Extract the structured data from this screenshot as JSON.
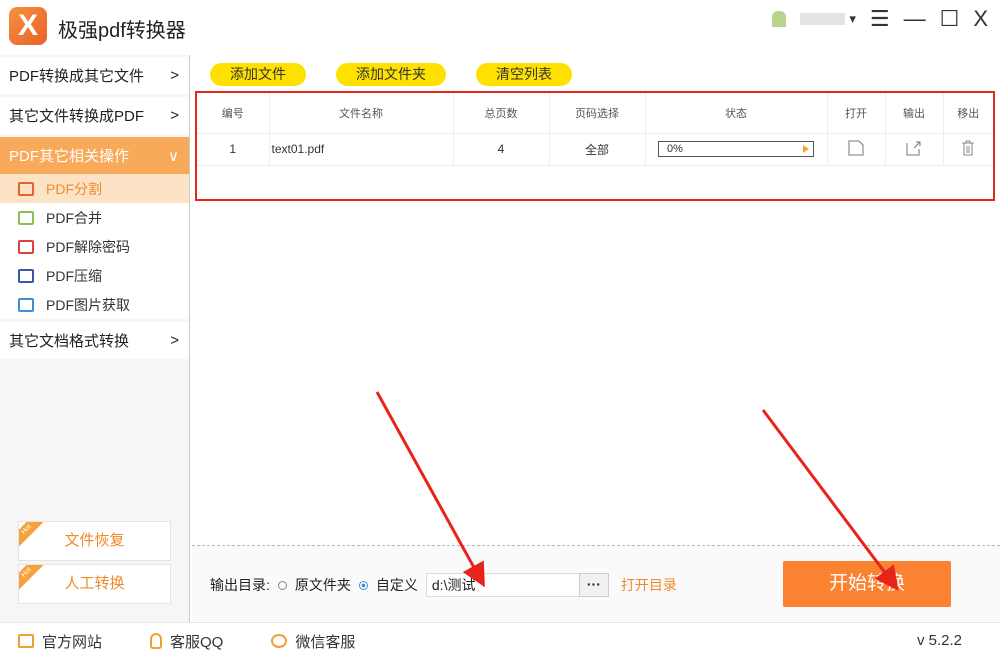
{
  "app": {
    "title": "极强pdf转换器",
    "logo_text": "X"
  },
  "window": {
    "menu_icon": "☰",
    "minimize": "—",
    "maximize": "☐",
    "close": "X",
    "dropdown": "▾"
  },
  "sidebar": {
    "categories": [
      {
        "label": "PDF转换成其它文件",
        "chevron": ">"
      },
      {
        "label": "其它文件转换成PDF",
        "chevron": ">"
      },
      {
        "label": "PDF其它相关操作",
        "chevron": "∨"
      },
      {
        "label": "其它文档格式转换",
        "chevron": ">"
      }
    ],
    "sub_items": [
      {
        "label": "PDF分割",
        "color": "#e8612a"
      },
      {
        "label": "PDF合并",
        "color": "#8cc152"
      },
      {
        "label": "PDF解除密码",
        "color": "#e04040"
      },
      {
        "label": "PDF压缩",
        "color": "#3a57a8"
      },
      {
        "label": "PDF图片获取",
        "color": "#3c8fd6"
      }
    ],
    "promos": [
      {
        "label": "文件恢复",
        "badge": "Hot"
      },
      {
        "label": "人工转换",
        "badge": "Hot"
      }
    ]
  },
  "toolbar": {
    "add_file": "添加文件",
    "add_folder": "添加文件夹",
    "clear_list": "清空列表"
  },
  "table": {
    "headers": [
      "编号",
      "文件名称",
      "总页数",
      "页码选择",
      "状态",
      "打开",
      "输出",
      "移出"
    ],
    "rows": [
      {
        "no": "1",
        "name": "text01.pdf",
        "pages": "4",
        "range": "全部",
        "status": "0%",
        "progress": 0
      }
    ]
  },
  "output": {
    "label": "输出目录:",
    "opt_original": "原文件夹",
    "opt_custom": "自定义",
    "selected": "自定义",
    "path": "d:\\测试",
    "browse": "···",
    "open_dir": "打开目录"
  },
  "start_button": "开始转换",
  "footer": {
    "website": "官方网站",
    "qq": "客服QQ",
    "wechat": "微信客服",
    "version": "v 5.2.2"
  },
  "colors": {
    "accent": "#fa8231",
    "toolbar_btn": "#ffe100",
    "highlight_border": "#e3261e",
    "active_cat": "#f8a95a"
  }
}
